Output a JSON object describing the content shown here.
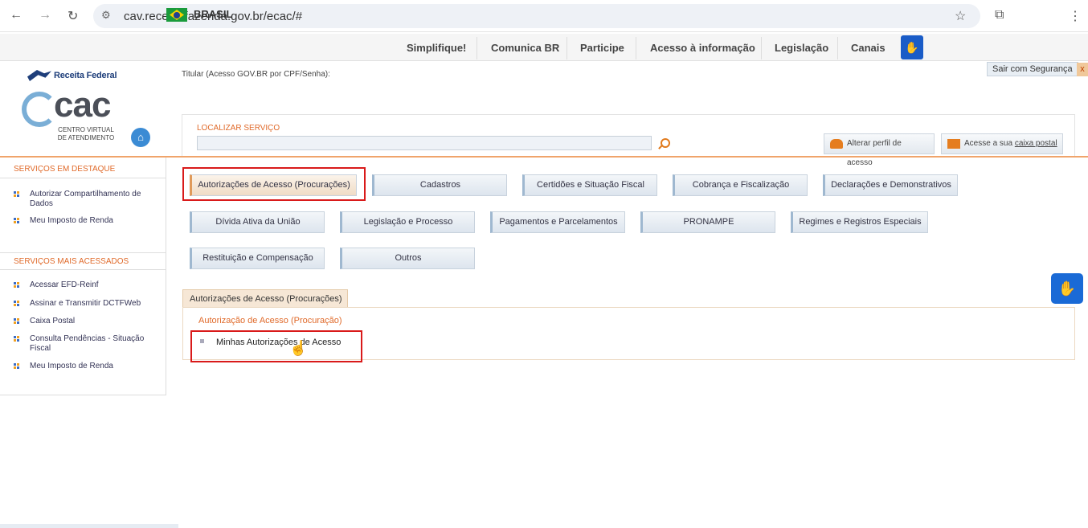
{
  "browser": {
    "url": "cav.receita.fazenda.gov.br/ecac/#",
    "back_icon": "arrow-left-icon",
    "forward_icon": "arrow-right-icon",
    "reload_icon": "reload-icon"
  },
  "govbar": {
    "country": "BRASIL",
    "links": [
      "Simplifique!",
      "Comunica BR",
      "Participe",
      "Acesso à informação",
      "Legislação",
      "Canais"
    ]
  },
  "header": {
    "rf_logo_text": "Receita Federal",
    "ecac_text": "cac",
    "ecac_sub1": "CENTRO VIRTUAL",
    "ecac_sub2": "DE ATENDIMENTO",
    "titular": "Titular (Acesso GOV.BR por CPF/Senha):",
    "sair": "Sair com Segurança",
    "sair_x": "x",
    "search_label": "LOCALIZAR SERVIÇO",
    "alterar_perfil": "Alterar perfil de acesso",
    "caixa_prefix": "Acesse a sua ",
    "caixa_link": "caixa postal"
  },
  "sidebar": {
    "destaque_title": "SERVIÇOS EM DESTAQUE",
    "destaque": [
      "Autorizar Compartilhamento de Dados",
      "Meu Imposto de Renda"
    ],
    "acessados_title": "SERVIÇOS MAIS ACESSADOS",
    "acessados": [
      "Acessar EFD-Reinf",
      "Assinar e Transmitir DCTFWeb",
      "Caixa Postal",
      "Consulta Pendências - Situação Fiscal",
      "Meu Imposto de Renda"
    ]
  },
  "categories": [
    "Autorizações de Acesso (Procurações)",
    "Cadastros",
    "Certidões e Situação Fiscal",
    "Cobrança e Fiscalização",
    "Declarações e Demonstrativos",
    "Dívida Ativa da União",
    "Legislação e Processo",
    "Pagamentos e Parcelamentos",
    "PRONAMPE",
    "Regimes e Registros Especiais",
    "Restituição e Compensação",
    "Outros"
  ],
  "panel": {
    "tab": "Autorizações de Acesso (Procurações)",
    "section_title": "Autorização de Acesso (Procuração)",
    "item": "Minhas Autorizações de Acesso"
  }
}
